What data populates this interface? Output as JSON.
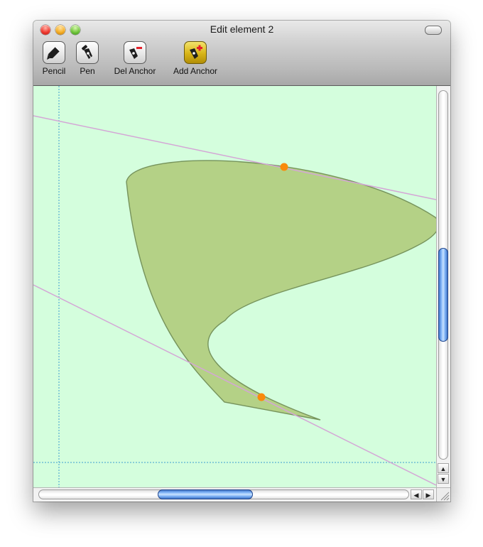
{
  "window": {
    "title": "Edit element 2"
  },
  "toolbar": {
    "tools": [
      {
        "label": "Pencil",
        "icon": "pencil-icon",
        "active": false
      },
      {
        "label": "Pen",
        "icon": "pen-nib-icon",
        "active": false
      },
      {
        "label": "Del Anchor",
        "icon": "delete-anchor-icon",
        "active": false
      },
      {
        "label": "Add Anchor",
        "icon": "add-anchor-icon",
        "active": true
      }
    ]
  },
  "scrollbars": {
    "vertical_up_arrow": "▲",
    "vertical_down_arrow": "▼",
    "horizontal_left_arrow": "◀",
    "horizontal_right_arrow": "▶"
  },
  "colors": {
    "canvas_background": "#d4fedd",
    "shape_fill": "#b4d186",
    "shape_stroke": "#76935c",
    "guide_line": "#d4a6d6",
    "margin_guide": "#3c9fd0",
    "anchor_point": "#f98a0c",
    "active_tool": "#d8b417"
  }
}
